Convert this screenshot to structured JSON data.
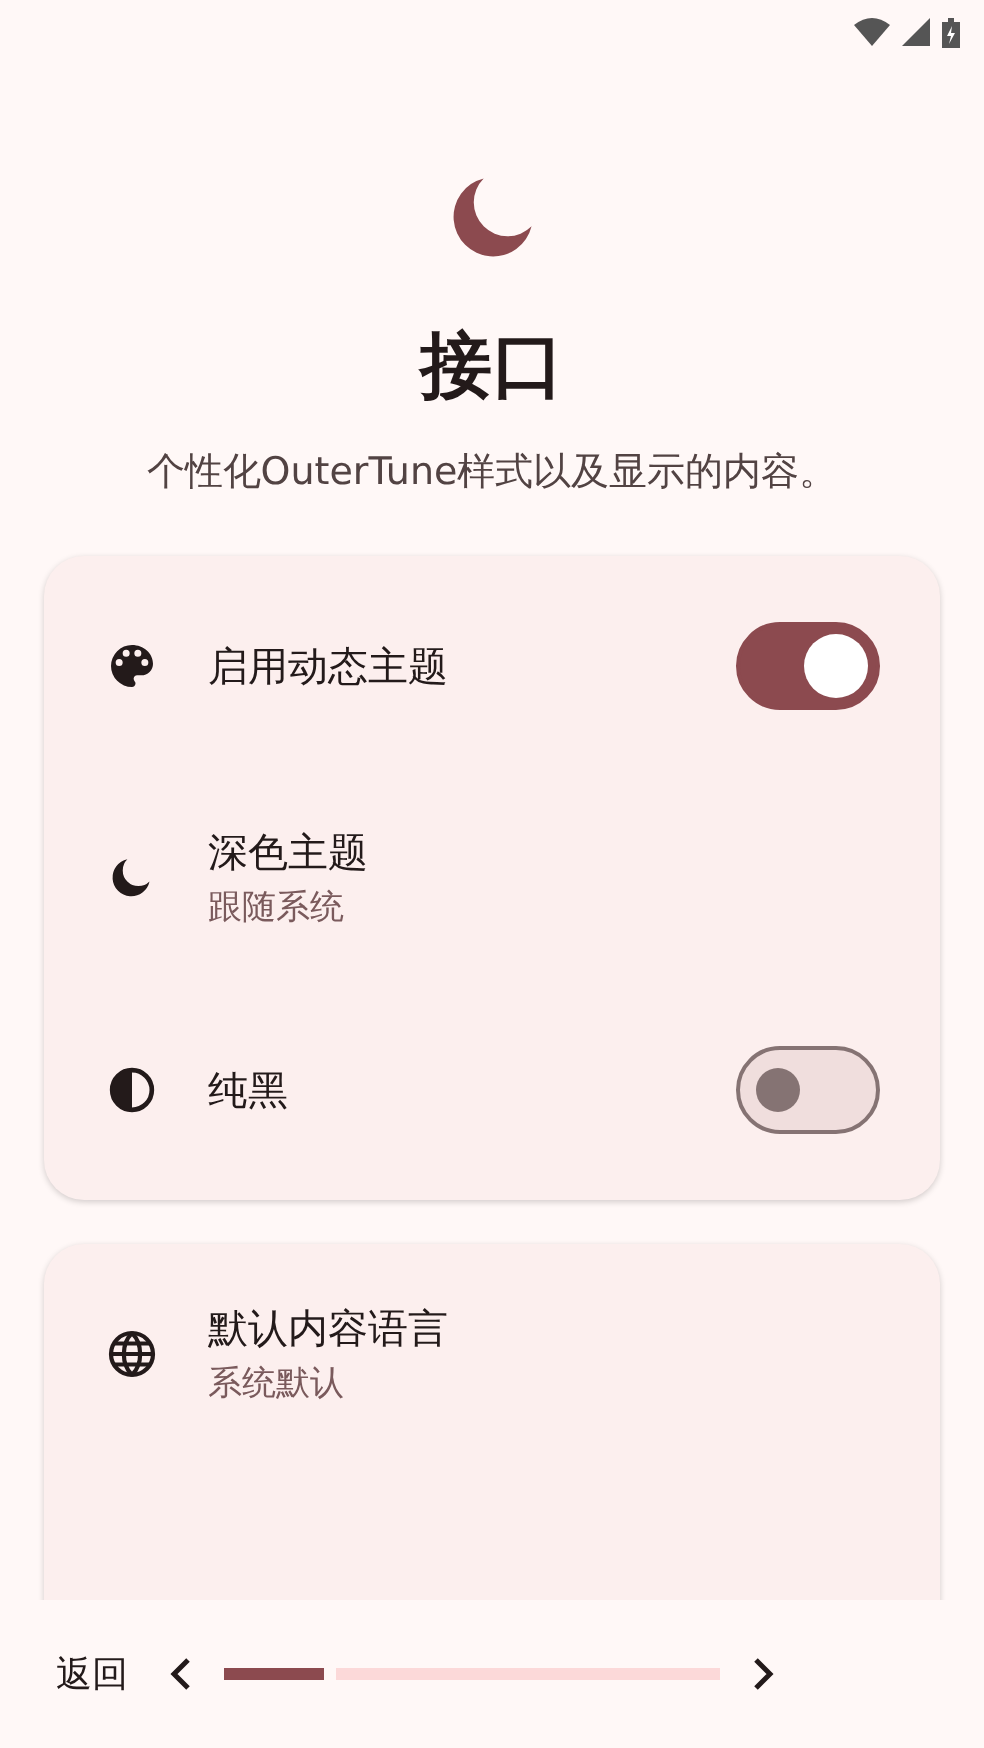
{
  "header": {
    "title": "接口",
    "description": "个性化OuterTune样式以及显示的内容。"
  },
  "cards": [
    {
      "items": [
        {
          "kind": "switch",
          "title": "启用动态主题",
          "on": true
        },
        {
          "kind": "value",
          "title": "深色主题",
          "subtitle": "跟随系统"
        },
        {
          "kind": "switch",
          "title": "纯黑",
          "on": false
        }
      ]
    },
    {
      "items": [
        {
          "kind": "value",
          "title": "默认内容语言",
          "subtitle": "系统默认"
        }
      ]
    }
  ],
  "bottom_bar": {
    "back": "返回",
    "progress": {
      "level": 0.2
    }
  }
}
